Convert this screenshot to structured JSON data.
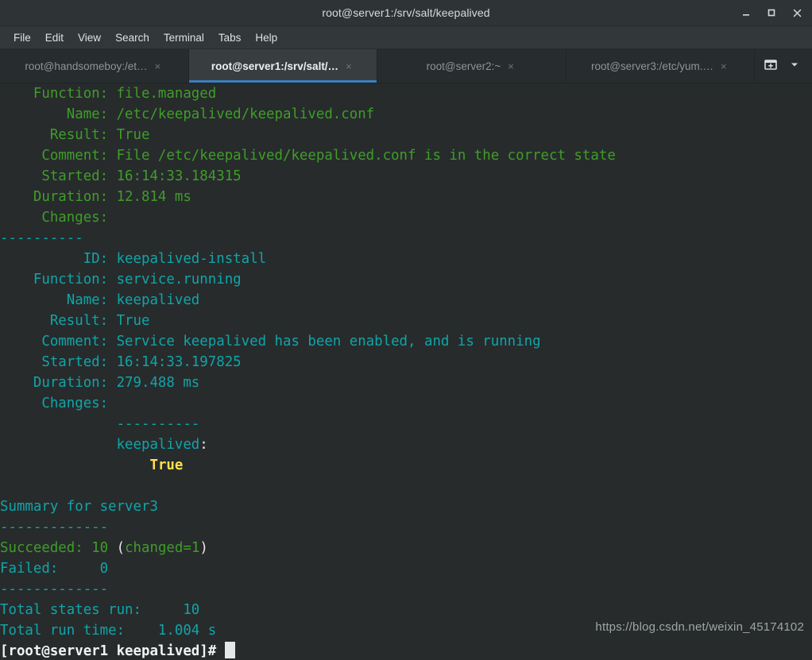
{
  "window": {
    "title": "root@server1:/srv/salt/keepalived",
    "controls": [
      {
        "name": "minimize",
        "glyph": "minimize-icon"
      },
      {
        "name": "maximize",
        "glyph": "maximize-icon"
      },
      {
        "name": "close",
        "glyph": "close-icon"
      }
    ]
  },
  "menubar": {
    "items": [
      "File",
      "Edit",
      "View",
      "Search",
      "Terminal",
      "Tabs",
      "Help"
    ]
  },
  "tabs": {
    "items": [
      {
        "label": "root@handsomeboy:/et…",
        "active": false,
        "close": "×"
      },
      {
        "label": "root@server1:/srv/salt/…",
        "active": true,
        "close": "×"
      },
      {
        "label": "root@server2:~",
        "active": false,
        "close": "×"
      },
      {
        "label": "root@server3:/etc/yum.…",
        "active": false,
        "close": "×"
      }
    ],
    "actions": [
      {
        "name": "new-tab-icon",
        "label": ""
      },
      {
        "name": "tab-list-dropdown-icon",
        "label": ""
      }
    ]
  },
  "terminal": {
    "colors": {
      "background": "#272b2c",
      "green": "#3f9d29",
      "cyan": "#10a5a8",
      "white": "#e8eaea",
      "yellow": "#ffe14d"
    },
    "lines": [
      {
        "id": "l01",
        "segments": [
          {
            "t": "    Function: file.managed",
            "c": "green"
          }
        ]
      },
      {
        "id": "l02",
        "segments": [
          {
            "t": "        Name: /etc/keepalived/keepalived.conf",
            "c": "green"
          }
        ]
      },
      {
        "id": "l03",
        "segments": [
          {
            "t": "      Result: True",
            "c": "green"
          }
        ]
      },
      {
        "id": "l04",
        "segments": [
          {
            "t": "     Comment: File /etc/keepalived/keepalived.conf is in the correct state",
            "c": "green"
          }
        ]
      },
      {
        "id": "l05",
        "segments": [
          {
            "t": "     Started: 16:14:33.184315",
            "c": "green"
          }
        ]
      },
      {
        "id": "l06",
        "segments": [
          {
            "t": "    Duration: 12.814 ms",
            "c": "green"
          }
        ]
      },
      {
        "id": "l07",
        "segments": [
          {
            "t": "     Changes:   ",
            "c": "green"
          }
        ]
      },
      {
        "id": "l08",
        "segments": [
          {
            "t": "----------",
            "c": "cyan"
          }
        ]
      },
      {
        "id": "l09",
        "segments": [
          {
            "t": "          ID: keepalived-install",
            "c": "cyan"
          }
        ]
      },
      {
        "id": "l10",
        "segments": [
          {
            "t": "    Function: service.running",
            "c": "cyan"
          }
        ]
      },
      {
        "id": "l11",
        "segments": [
          {
            "t": "        Name: keepalived",
            "c": "cyan"
          }
        ]
      },
      {
        "id": "l12",
        "segments": [
          {
            "t": "      Result: True",
            "c": "cyan"
          }
        ]
      },
      {
        "id": "l13",
        "segments": [
          {
            "t": "     Comment: Service keepalived has been enabled, and is running",
            "c": "cyan"
          }
        ]
      },
      {
        "id": "l14",
        "segments": [
          {
            "t": "     Started: 16:14:33.197825",
            "c": "cyan"
          }
        ]
      },
      {
        "id": "l15",
        "segments": [
          {
            "t": "    Duration: 279.488 ms",
            "c": "cyan"
          }
        ]
      },
      {
        "id": "l16",
        "segments": [
          {
            "t": "     Changes:   ",
            "c": "cyan"
          }
        ]
      },
      {
        "id": "l17",
        "segments": [
          {
            "t": "              ----------",
            "c": "cyan"
          }
        ]
      },
      {
        "id": "l18",
        "segments": [
          {
            "t": "              keepalived",
            "c": "cyan"
          },
          {
            "t": ":",
            "c": "white"
          }
        ]
      },
      {
        "id": "l19",
        "segments": [
          {
            "t": "                  ",
            "c": "white"
          },
          {
            "t": "True",
            "c": "yellow"
          }
        ]
      },
      {
        "id": "l20",
        "segments": [
          {
            "t": "",
            "c": "white"
          }
        ]
      },
      {
        "id": "l21",
        "segments": [
          {
            "t": "Summary for server3",
            "c": "cyan"
          }
        ]
      },
      {
        "id": "l22",
        "segments": [
          {
            "t": "-------------",
            "c": "cyan"
          }
        ]
      },
      {
        "id": "l23",
        "segments": [
          {
            "t": "Succeeded: 10 ",
            "c": "green"
          },
          {
            "t": "(",
            "c": "white"
          },
          {
            "t": "changed=1",
            "c": "green"
          },
          {
            "t": ")",
            "c": "white"
          }
        ]
      },
      {
        "id": "l24",
        "segments": [
          {
            "t": "Failed:     0",
            "c": "cyan"
          }
        ]
      },
      {
        "id": "l25",
        "segments": [
          {
            "t": "-------------",
            "c": "cyan"
          }
        ]
      },
      {
        "id": "l26",
        "segments": [
          {
            "t": "Total states run:     10",
            "c": "cyan"
          }
        ]
      },
      {
        "id": "l27",
        "segments": [
          {
            "t": "Total run time:    1.004 s",
            "c": "cyan"
          }
        ]
      }
    ],
    "prompt": {
      "text": "[root@server1 keepalived]# ",
      "cursor": "block"
    }
  },
  "watermark": {
    "text": "https://blog.csdn.net/weixin_45174102"
  }
}
